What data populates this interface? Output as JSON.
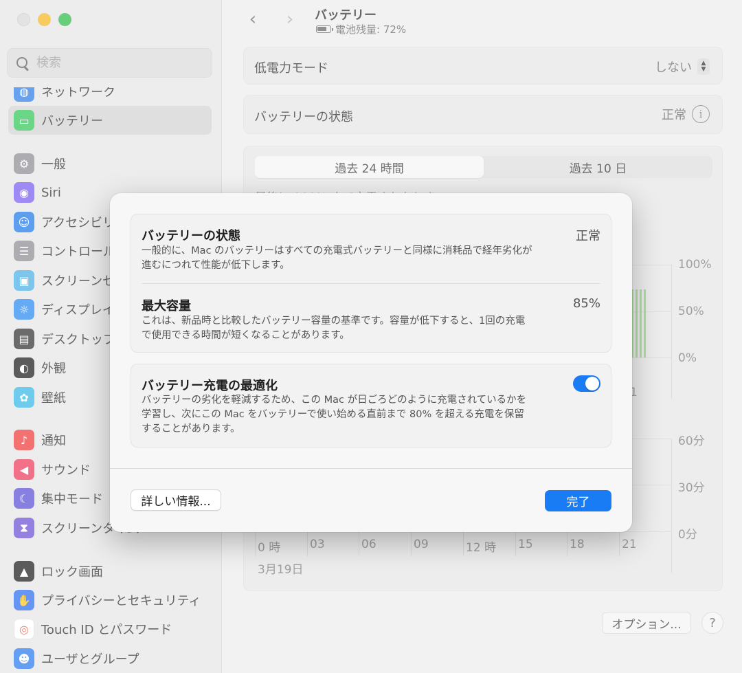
{
  "sidebar": {
    "search_placeholder": "検索",
    "items": [
      {
        "label": "ネットワーク",
        "icon": "globe-icon",
        "color": "#2f7fe8",
        "top": 0
      },
      {
        "label": "バッテリー",
        "icon": "battery-icon",
        "color": "#34c759",
        "top": 1,
        "selected": true
      },
      {
        "label": "一般",
        "icon": "gear-icon",
        "color": "#8e8e93"
      },
      {
        "label": "Siri",
        "icon": "siri-icon",
        "color": "#7a5cf0"
      },
      {
        "label": "アクセシビリティ",
        "icon": "accessibility-icon",
        "color": "#1f7ae8"
      },
      {
        "label": "コントロールセンター",
        "icon": "control-center-icon",
        "color": "#8e8e93"
      },
      {
        "label": "スクリーンセーバ",
        "icon": "screensaver-icon",
        "color": "#4ab0e8"
      },
      {
        "label": "ディスプレイ",
        "icon": "display-icon",
        "color": "#2a8af0"
      },
      {
        "label": "デスクトップとDock",
        "icon": "desktop-icon",
        "color": "#333333"
      },
      {
        "label": "外観",
        "icon": "appearance-icon",
        "color": "#1c1c1e"
      },
      {
        "label": "壁紙",
        "icon": "wallpaper-icon",
        "color": "#38b8e8"
      },
      {
        "label": "通知",
        "icon": "bell-icon",
        "color": "#ef3b3b"
      },
      {
        "label": "サウンド",
        "icon": "speaker-icon",
        "color": "#ef3b5b"
      },
      {
        "label": "集中モード",
        "icon": "moon-icon",
        "color": "#5b4fd6"
      },
      {
        "label": "スクリーンタイム",
        "icon": "hourglass-icon",
        "color": "#6b4fd6"
      },
      {
        "label": "ロック画面",
        "icon": "lock-icon",
        "color": "#1c1c1e"
      },
      {
        "label": "プライバシーとセキュリティ",
        "icon": "hand-icon",
        "color": "#2a6ef0"
      },
      {
        "label": "Touch ID とパスワード",
        "icon": "fingerprint-icon",
        "color": "#ffffff"
      },
      {
        "label": "ユーザとグループ",
        "icon": "users-icon",
        "color": "#2a7af0"
      }
    ]
  },
  "header": {
    "title": "バッテリー",
    "subtitle": "電池残量: 72%"
  },
  "main": {
    "low_power": {
      "label": "低電力モード",
      "value": "しない"
    },
    "battery_health": {
      "label": "バッテリーの状態",
      "value": "正常"
    },
    "tabs": [
      {
        "label": "過去 24 時間",
        "active": true
      },
      {
        "label": "過去 10 日",
        "active": false
      }
    ],
    "last_charged_label": "最後に 100% まで充電されたとき",
    "level_axis": [
      "100%",
      "50%",
      "0%"
    ],
    "usage_axis": [
      "60分",
      "30分",
      "0分"
    ],
    "x_ticks": [
      "0 時",
      "03",
      "06",
      "09",
      "12 時",
      "15",
      "18",
      "21"
    ],
    "partial_tick": "1",
    "date_label": "3月19日",
    "options_label": "オプション...",
    "help_label": "?"
  },
  "modal": {
    "health": {
      "title": "バッテリーの状態",
      "value": "正常",
      "desc_line1": "一般的に、Mac のバッテリーはすべての充電式バッテリーと同様に消耗品で経年劣化が",
      "desc_line2": "進むにつれて性能が低下します。"
    },
    "capacity": {
      "title": "最大容量",
      "value": "85%",
      "desc_line1": "これは、新品時と比較したバッテリー容量の基準です。容量が低下すると、1回の充電",
      "desc_line2": "で使用できる時間が短くなることがあります。"
    },
    "optimize": {
      "title": "バッテリー充電の最適化",
      "enabled": true,
      "desc_line1": "バッテリーの劣化を軽減するため、この Mac が日ごろどのように充電されているかを",
      "desc_line2": "学習し、次にこの Mac をバッテリーで使い始める直前まで 80% を超える充電を保留",
      "desc_line3": "することがあります。"
    },
    "more_info_label": "詳しい情報...",
    "done_label": "完了"
  },
  "colors": {
    "accent": "#1a7cf5",
    "chart_bar": "#8dd37a"
  }
}
